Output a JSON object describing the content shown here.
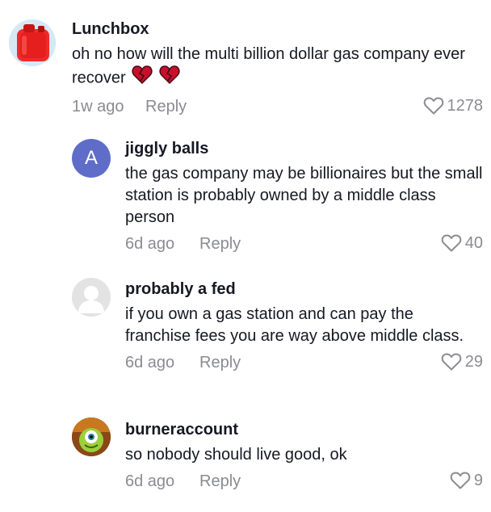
{
  "comments": [
    {
      "username": "Lunchbox",
      "text": "oh no how will the multi billion dollar gas company ever recover",
      "emoji": "broken-heart-icon",
      "time": "1w ago",
      "reply_label": "Reply",
      "likes": "1278",
      "avatar": "gas-can-avatar"
    },
    {
      "username": "jiggly balls",
      "text": "the gas company may be billionaires but the small station is probably owned by a middle class person",
      "time": "6d ago",
      "reply_label": "Reply",
      "likes": "40",
      "avatar_letter": "A",
      "avatar_color": "#5f6dc9"
    },
    {
      "username": "probably a fed",
      "text": "if you own a gas station and can pay the franchise fees you are way above middle class.",
      "time": "6d ago",
      "reply_label": "Reply",
      "likes": "29",
      "avatar": "default-avatar"
    },
    {
      "username": "burneraccount",
      "text": "so nobody should live good, ok",
      "time": "6d ago",
      "reply_label": "Reply",
      "likes": "9",
      "avatar": "one-eyed-monster-avatar"
    }
  ],
  "colors": {
    "primary_text": "#161823",
    "secondary_text": "#8a8b91",
    "broken_heart": "#c8102e"
  }
}
